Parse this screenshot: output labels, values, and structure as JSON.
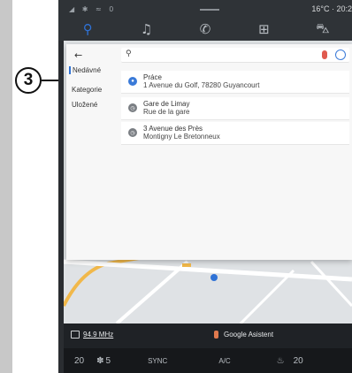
{
  "callout": {
    "number": "3"
  },
  "status": {
    "left_icons": "◢ ✱ ≈ 0",
    "right_text": "16°C · 20:2"
  },
  "nav": {
    "tabs": [
      {
        "icon": "map-pin-icon",
        "glyph": "⚲",
        "active": true
      },
      {
        "icon": "music-note-icon",
        "glyph": "♫",
        "active": false
      },
      {
        "icon": "phone-icon",
        "glyph": "✆",
        "active": false
      },
      {
        "icon": "apps-grid-icon",
        "glyph": "⊞",
        "active": false
      },
      {
        "icon": "car-icon",
        "glyph": "⛍",
        "active": false
      }
    ]
  },
  "side_menu": {
    "back_glyph": "←",
    "items": [
      "Nedávné",
      "Kategorie",
      "Uložené"
    ]
  },
  "search": {
    "icon_glyph": "⚲"
  },
  "results": [
    {
      "type": "pin",
      "glyph": "●",
      "title": "Práce",
      "subtitle": "1 Avenue du Golf, 78280 Guyancourt"
    },
    {
      "type": "clock",
      "glyph": "◷",
      "title": "Gare de Limay",
      "subtitle": "Rue de la gare"
    },
    {
      "type": "clock",
      "glyph": "◷",
      "title": "3 Avenue des Près",
      "subtitle": "Montigny Le Bretonneux"
    }
  ],
  "media": {
    "frequency": "94.9 MHz",
    "assistant": "Google Asistent"
  },
  "climate": {
    "left_temp": "20",
    "fan_speed": "5",
    "sync": "SYNC",
    "ac": "A/C",
    "right_temp": "20"
  }
}
